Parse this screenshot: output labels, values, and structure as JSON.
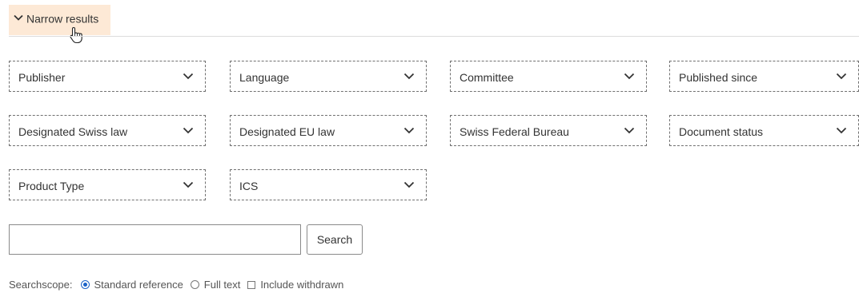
{
  "narrow": {
    "label": "Narrow results",
    "icon": "chevron-down-icon",
    "bg_color": "#fde9d6"
  },
  "filters": [
    {
      "label": "Publisher"
    },
    {
      "label": "Language"
    },
    {
      "label": "Committee"
    },
    {
      "label": "Published since"
    },
    {
      "label": "Designated Swiss law"
    },
    {
      "label": "Designated EU law"
    },
    {
      "label": "Swiss Federal Bureau"
    },
    {
      "label": "Document status"
    },
    {
      "label": "Product Type"
    },
    {
      "label": "ICS"
    }
  ],
  "search": {
    "value": "",
    "placeholder": "",
    "button_label": "Search"
  },
  "scope": {
    "label": "Searchscope:",
    "options": [
      {
        "label": "Standard reference",
        "type": "radio",
        "checked": true
      },
      {
        "label": "Full text",
        "type": "radio",
        "checked": false
      },
      {
        "label": "Include withdrawn",
        "type": "checkbox",
        "checked": false
      }
    ],
    "accent_color": "#1a62c8"
  }
}
